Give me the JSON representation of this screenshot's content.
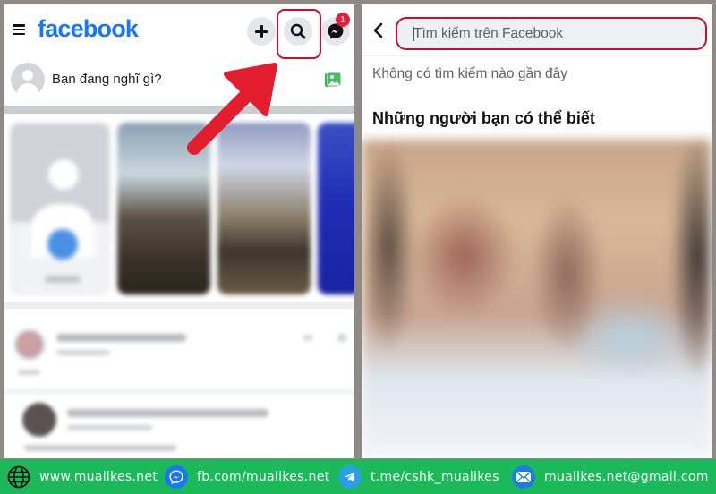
{
  "left_panel": {
    "header": {
      "logo_text": "facebook",
      "menu_icon": "hamburger-menu-icon",
      "buttons": [
        {
          "name": "create",
          "icon": "plus-icon"
        },
        {
          "name": "search",
          "icon": "search-icon",
          "highlighted": true
        },
        {
          "name": "messenger",
          "icon": "messenger-icon",
          "badge": "1"
        }
      ]
    },
    "composer": {
      "placeholder": "Bạn đang nghĩ gì?",
      "photo_icon": "photo-icon"
    },
    "annotation": {
      "type": "arrow",
      "color": "#e11d2e",
      "points_to": "search"
    }
  },
  "right_panel": {
    "back_icon": "chevron-left-icon",
    "search": {
      "placeholder": "Tìm kiếm trên Facebook",
      "value": ""
    },
    "recent_text": "Không có tìm kiếm nào gần đây",
    "section_title": "Những người bạn có thể biết"
  },
  "footer": {
    "background": "#1bb95a",
    "items": [
      {
        "icon": "globe-icon",
        "text": "www.mualikes.net"
      },
      {
        "icon": "messenger-icon",
        "text": "fb.com/mualikes.net"
      },
      {
        "icon": "telegram-icon",
        "text": "t.me/cshk_mualikes"
      },
      {
        "icon": "mail-icon",
        "text": "mualikes.net@gmail.com"
      }
    ]
  },
  "colors": {
    "facebook_blue": "#1877f2",
    "highlight_red": "#c8102e",
    "badge_red": "#e41e3f"
  }
}
